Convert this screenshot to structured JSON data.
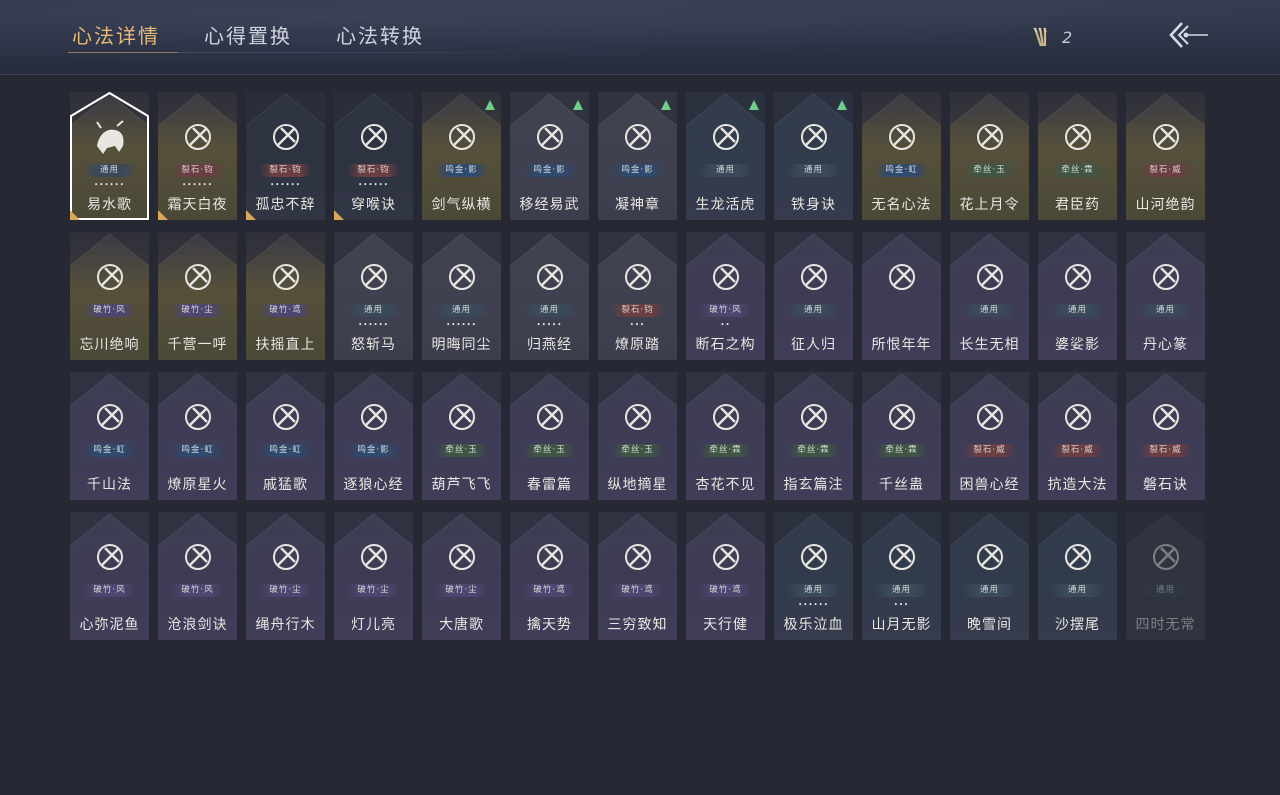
{
  "tabs": [
    {
      "label": "心法详情",
      "active": true
    },
    {
      "label": "心得置换",
      "active": false
    },
    {
      "label": "心法转换",
      "active": false
    }
  ],
  "currency": {
    "icon": "arrows-token-icon",
    "value": "2"
  },
  "back_icon": "back-arrow-icon",
  "colors": {
    "accent": "#e5b977",
    "upgrade": "#6fcf8a",
    "background": "#262834"
  },
  "cards": [
    {
      "name": "易水歌",
      "badge": "通用",
      "badge_style": "b-common",
      "dots": "••••••",
      "bg": "gold",
      "icon": "bull-icon",
      "selected": true,
      "corner": true,
      "up": false
    },
    {
      "name": "霜天白夜",
      "badge": "裂石·钧",
      "badge_style": "b-red",
      "dots": "••••••",
      "bg": "gold",
      "icon": "sword-icon",
      "corner": true,
      "up": false
    },
    {
      "name": "孤忠不辞",
      "badge": "裂石·钧",
      "badge_style": "b-red",
      "dots": "••••••",
      "bg": "dark",
      "icon": "crossed-spears-icon",
      "corner": true,
      "up": false
    },
    {
      "name": "穿喉诀",
      "badge": "裂石·钧",
      "badge_style": "b-red",
      "dots": "••••••",
      "bg": "dark",
      "icon": "wave-boat-icon",
      "corner": true,
      "up": false
    },
    {
      "name": "剑气纵横",
      "badge": "鸣金·影",
      "badge_style": "b-blue",
      "dots": "",
      "bg": "gold",
      "icon": "swirl-sword-icon",
      "up": true
    },
    {
      "name": "移经易武",
      "badge": "鸣金·影",
      "badge_style": "b-blue",
      "dots": "",
      "bg": "grey",
      "icon": "armor-icon",
      "up": true
    },
    {
      "name": "凝神章",
      "badge": "鸣金·影",
      "badge_style": "b-blue",
      "dots": "",
      "bg": "grey",
      "icon": "bow-icon",
      "up": true
    },
    {
      "name": "生龙活虎",
      "badge": "通用",
      "badge_style": "b-common",
      "dots": "",
      "bg": "blue",
      "icon": "running-man-icon",
      "up": true
    },
    {
      "name": "铁身诀",
      "badge": "通用",
      "badge_style": "b-common",
      "dots": "",
      "bg": "blue",
      "icon": "muscle-icon",
      "up": true
    },
    {
      "name": "无名心法",
      "badge": "鸣金·虹",
      "badge_style": "b-blue",
      "dots": "",
      "bg": "gold",
      "icon": "staff-icon",
      "up": false
    },
    {
      "name": "花上月令",
      "badge": "牵丝·玉",
      "badge_style": "b-green",
      "dots": "",
      "bg": "gold",
      "icon": "flower-moon-icon",
      "up": false
    },
    {
      "name": "君臣药",
      "badge": "牵丝·霖",
      "badge_style": "b-green",
      "dots": "",
      "bg": "gold",
      "icon": "herb-vase-icon",
      "up": false
    },
    {
      "name": "山河绝韵",
      "badge": "裂石·威",
      "badge_style": "b-red",
      "dots": "",
      "bg": "gold",
      "icon": "mountain-icon",
      "up": false
    },
    {
      "name": "忘川绝响",
      "badge": "破竹·风",
      "badge_style": "b-purple",
      "dots": "",
      "bg": "gold",
      "icon": "mask-icon",
      "up": false
    },
    {
      "name": "千营一呼",
      "badge": "破竹·尘",
      "badge_style": "b-purple",
      "dots": "",
      "bg": "gold",
      "icon": "flag-icon",
      "up": false
    },
    {
      "name": "扶摇直上",
      "badge": "破竹·鸢",
      "badge_style": "b-purple",
      "dots": "",
      "bg": "gold",
      "icon": "eagle-icon",
      "up": false
    },
    {
      "name": "怒斩马",
      "badge": "通用",
      "badge_style": "b-common",
      "dots": "••••••",
      "bg": "grey",
      "icon": "blade-icon",
      "up": false
    },
    {
      "name": "明晦同尘",
      "badge": "通用",
      "badge_style": "b-common",
      "dots": "••••••",
      "bg": "grey",
      "icon": "serpent-staff-icon",
      "up": false
    },
    {
      "name": "归燕经",
      "badge": "通用",
      "badge_style": "b-common",
      "dots": "•••••",
      "bg": "grey",
      "icon": "swallow-icon",
      "up": false
    },
    {
      "name": "燎原踏",
      "badge": "裂石·钧",
      "badge_style": "b-red",
      "dots": "•••",
      "bg": "grey",
      "icon": "horse-icon",
      "up": false
    },
    {
      "name": "断石之构",
      "badge": "破竹·风",
      "badge_style": "b-purple",
      "dots": "••",
      "bg": "purple",
      "icon": "warrior-icon",
      "up": false
    },
    {
      "name": "征人归",
      "badge": "通用",
      "badge_style": "b-common",
      "dots": "",
      "bg": "purple",
      "icon": "bird-hand-icon",
      "up": false
    },
    {
      "name": "所恨年年",
      "badge": "",
      "badge_style": "",
      "dots": "",
      "bg": "purple",
      "icon": "bamboo-icon",
      "up": false
    },
    {
      "name": "长生无相",
      "badge": "通用",
      "badge_style": "b-common",
      "dots": "",
      "bg": "purple",
      "icon": "statue-icon",
      "up": false
    },
    {
      "name": "婆娑影",
      "badge": "通用",
      "badge_style": "b-common",
      "dots": "",
      "bg": "purple",
      "icon": "dragon-icon",
      "up": false
    },
    {
      "name": "丹心篆",
      "badge": "通用",
      "badge_style": "b-common",
      "dots": "",
      "bg": "purple",
      "icon": "broken-scroll-icon",
      "up": false
    },
    {
      "name": "千山法",
      "badge": "鸣金·虹",
      "badge_style": "b-blue",
      "dots": "",
      "bg": "purple",
      "icon": "peaks-icon",
      "up": false
    },
    {
      "name": "燎原星火",
      "badge": "鸣金·虹",
      "badge_style": "b-blue",
      "dots": "",
      "bg": "purple",
      "icon": "scythe-icon",
      "up": false
    },
    {
      "name": "戚猛歌",
      "badge": "鸣金·虹",
      "badge_style": "b-blue",
      "dots": "",
      "bg": "purple",
      "icon": "fist-icon",
      "up": false
    },
    {
      "name": "逐狼心经",
      "badge": "鸣金·影",
      "badge_style": "b-blue",
      "dots": "",
      "bg": "purple",
      "icon": "wolf-icon",
      "up": false
    },
    {
      "name": "葫芦飞飞",
      "badge": "牵丝·玉",
      "badge_style": "b-green",
      "dots": "",
      "bg": "purple",
      "icon": "gourd-icon",
      "up": false
    },
    {
      "name": "春雷篇",
      "badge": "牵丝·玉",
      "badge_style": "b-green",
      "dots": "",
      "bg": "purple",
      "icon": "lightning-tree-icon",
      "up": false
    },
    {
      "name": "纵地摘星",
      "badge": "牵丝·玉",
      "badge_style": "b-green",
      "dots": "",
      "bg": "purple",
      "icon": "star-figure-icon",
      "up": false
    },
    {
      "name": "杏花不见",
      "badge": "牵丝·霖",
      "badge_style": "b-green",
      "dots": "",
      "bg": "purple",
      "icon": "blossom-icon",
      "up": false
    },
    {
      "name": "指玄篇注",
      "badge": "牵丝·霖",
      "badge_style": "b-green",
      "dots": "",
      "bg": "purple",
      "icon": "yin-yang-icon",
      "up": false
    },
    {
      "name": "千丝蛊",
      "badge": "牵丝·霖",
      "badge_style": "b-green",
      "dots": "",
      "bg": "purple",
      "icon": "leaf-icon",
      "up": false
    },
    {
      "name": "困兽心经",
      "badge": "裂石·威",
      "badge_style": "b-red",
      "dots": "",
      "bg": "purple",
      "icon": "shackle-icon",
      "up": false
    },
    {
      "name": "抗造大法",
      "badge": "裂石·威",
      "badge_style": "b-red",
      "dots": "",
      "bg": "purple",
      "icon": "bell-icon",
      "up": false
    },
    {
      "name": "磐石诀",
      "badge": "裂石·威",
      "badge_style": "b-red",
      "dots": "",
      "bg": "purple",
      "icon": "rock-icon",
      "up": false
    },
    {
      "name": "心弥泥鱼",
      "badge": "破竹·风",
      "badge_style": "b-purple",
      "dots": "",
      "bg": "purple",
      "icon": "fish-icon",
      "up": false
    },
    {
      "name": "沧浪剑诀",
      "badge": "破竹·风",
      "badge_style": "b-purple",
      "dots": "",
      "bg": "purple",
      "icon": "coiled-dragon-icon",
      "up": false
    },
    {
      "name": "绳舟行木",
      "badge": "破竹·尘",
      "badge_style": "b-purple",
      "dots": "",
      "bg": "purple",
      "icon": "roots-icon",
      "up": false
    },
    {
      "name": "灯儿亮",
      "badge": "破竹·尘",
      "badge_style": "b-purple",
      "dots": "",
      "bg": "purple",
      "icon": "lantern-icon",
      "up": false
    },
    {
      "name": "大唐歌",
      "badge": "破竹·尘",
      "badge_style": "b-purple",
      "dots": "",
      "bg": "purple",
      "icon": "city-icon",
      "up": false
    },
    {
      "name": "擒天势",
      "badge": "破竹·鸢",
      "badge_style": "b-purple",
      "dots": "",
      "bg": "purple",
      "icon": "chain-fist-icon",
      "up": false
    },
    {
      "name": "三穷致知",
      "badge": "破竹·鸢",
      "badge_style": "b-purple",
      "dots": "",
      "bg": "purple",
      "icon": "book-icon",
      "up": false
    },
    {
      "name": "天行健",
      "badge": "破竹·鸢",
      "badge_style": "b-purple",
      "dots": "",
      "bg": "purple",
      "icon": "umbrella-icon",
      "up": false
    },
    {
      "name": "极乐泣血",
      "badge": "通用",
      "badge_style": "b-common",
      "dots": "••••••",
      "bg": "blue",
      "icon": "slash-icon",
      "up": false
    },
    {
      "name": "山月无影",
      "badge": "通用",
      "badge_style": "b-common",
      "dots": "•••",
      "bg": "blue",
      "icon": "claw-slash-icon",
      "up": false
    },
    {
      "name": "晚雪间",
      "badge": "通用",
      "badge_style": "b-common",
      "dots": "",
      "bg": "blue",
      "icon": "crosshair-circle-icon",
      "up": false
    },
    {
      "name": "沙摆尾",
      "badge": "通用",
      "badge_style": "b-common",
      "dots": "",
      "bg": "blue",
      "icon": "feather-swirl-icon",
      "up": false
    },
    {
      "name": "四时无常",
      "badge": "通用",
      "badge_style": "b-common",
      "dots": "",
      "bg": "grey",
      "icon": "lock-seal-icon",
      "up": false,
      "faded": true
    }
  ]
}
